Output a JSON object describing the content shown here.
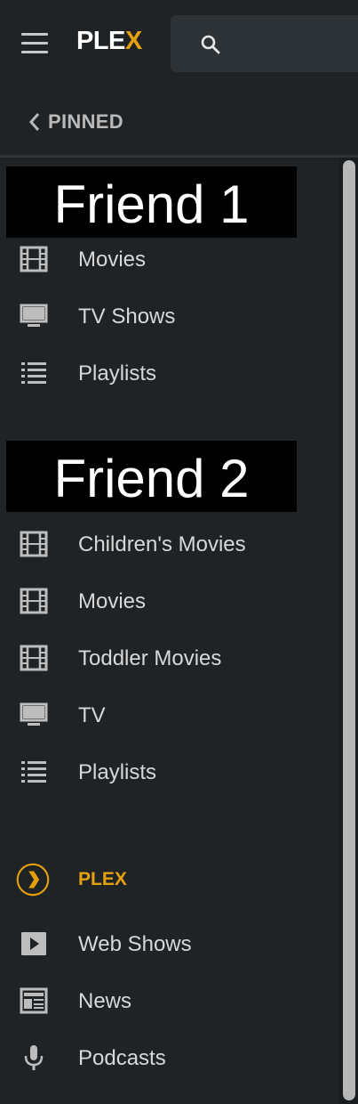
{
  "header": {
    "logo_prefix": "PLE",
    "logo_accent": "X",
    "menu_icon": "hamburger-icon",
    "search_icon": "search-icon"
  },
  "nav": {
    "back_label": "PINNED"
  },
  "friend1": {
    "title": "Friend 1",
    "items": [
      {
        "label": "Movies",
        "icon": "film-icon"
      },
      {
        "label": "TV Shows",
        "icon": "tv-icon"
      },
      {
        "label": "Playlists",
        "icon": "list-icon"
      }
    ]
  },
  "friend2": {
    "title": "Friend 2",
    "items": [
      {
        "label": "Children's Movies",
        "icon": "film-icon"
      },
      {
        "label": "Movies",
        "icon": "film-icon"
      },
      {
        "label": "Toddler Movies",
        "icon": "film-icon"
      },
      {
        "label": "TV",
        "icon": "tv-icon"
      },
      {
        "label": "Playlists",
        "icon": "list-icon"
      }
    ]
  },
  "plex_section": {
    "title": "PLEX",
    "items": [
      {
        "label": "Web Shows",
        "icon": "play-icon"
      },
      {
        "label": "News",
        "icon": "news-icon"
      },
      {
        "label": "Podcasts",
        "icon": "microphone-icon"
      }
    ]
  },
  "colors": {
    "background": "#1f2326",
    "accent": "#e5a00d",
    "text": "#d8d8d8"
  }
}
